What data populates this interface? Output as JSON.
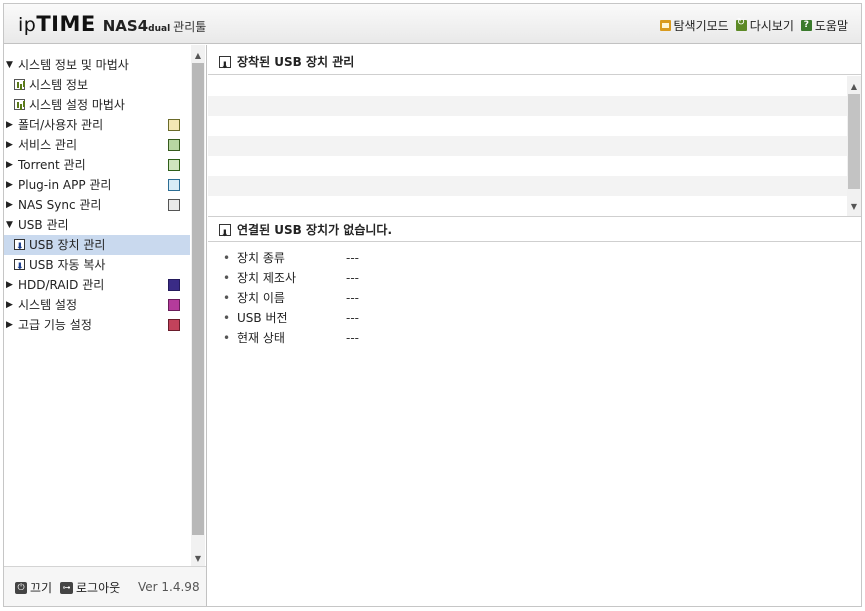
{
  "header": {
    "logo_ip": "ip",
    "logo_time": "TIME",
    "logo_nas": "NAS4",
    "logo_dual": "dual",
    "logo_admin": "관리툴",
    "links": [
      {
        "label": "탐색기모드",
        "icon": "explorer-mode-icon"
      },
      {
        "label": "다시보기",
        "icon": "reload-icon"
      },
      {
        "label": "도움말",
        "icon": "help-icon"
      }
    ]
  },
  "sidebar": {
    "items": [
      {
        "label": "시스템 정보 및 마법사",
        "kind": "group",
        "expanded": true
      },
      {
        "label": "시스템 정보",
        "kind": "sub",
        "icon": "chart-icon"
      },
      {
        "label": "시스템 설정 마법사",
        "kind": "sub",
        "icon": "chart-icon"
      },
      {
        "label": "폴더/사용자 관리",
        "kind": "group",
        "expanded": false,
        "icon": "folder-user-icon"
      },
      {
        "label": "서비스 관리",
        "kind": "group",
        "expanded": false,
        "icon": "service-icon"
      },
      {
        "label": "Torrent 관리",
        "kind": "group",
        "expanded": false,
        "icon": "torrent-icon"
      },
      {
        "label": "Plug-in APP 관리",
        "kind": "group",
        "expanded": false,
        "icon": "plugin-icon"
      },
      {
        "label": "NAS Sync 관리",
        "kind": "group",
        "expanded": false,
        "icon": "sync-icon"
      },
      {
        "label": "USB 관리",
        "kind": "group",
        "expanded": true
      },
      {
        "label": "USB 장치 관리",
        "kind": "sub",
        "icon": "usb-icon",
        "selected": true
      },
      {
        "label": "USB 자동 복사",
        "kind": "sub",
        "icon": "usb-icon"
      },
      {
        "label": "HDD/RAID 관리",
        "kind": "group",
        "expanded": false,
        "icon": "hdd-icon"
      },
      {
        "label": "시스템 설정",
        "kind": "group",
        "expanded": false,
        "icon": "system-settings-icon"
      },
      {
        "label": "고급 기능 설정",
        "kind": "group",
        "expanded": false,
        "icon": "advanced-icon"
      }
    ],
    "footer": {
      "power_label": "끄기",
      "logout_label": "로그아웃",
      "version": "Ver 1.4.98"
    }
  },
  "main": {
    "mounted_title": "장착된 USB 장치 관리",
    "connected_title": "연결된 USB 장치가 없습니다.",
    "details": [
      {
        "label": "장치 종류",
        "value": "---"
      },
      {
        "label": "장치 제조사",
        "value": "---"
      },
      {
        "label": "장치 이름",
        "value": "---"
      },
      {
        "label": "USB 버전",
        "value": "---"
      },
      {
        "label": "현재 상태",
        "value": "---"
      }
    ]
  }
}
